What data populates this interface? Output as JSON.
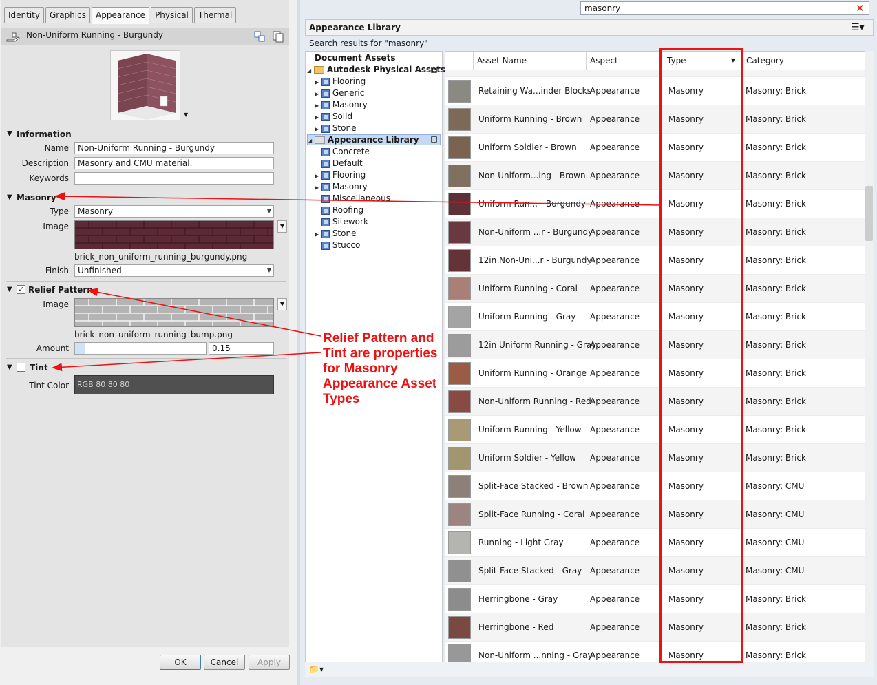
{
  "tabs": [
    "Identity",
    "Graphics",
    "Appearance",
    "Physical",
    "Thermal"
  ],
  "active_tab": "Appearance",
  "asset_title": "Non-Uniform Running - Burgundy",
  "information": {
    "heading": "Information",
    "name_label": "Name",
    "name_value": "Non-Uniform Running - Burgundy",
    "desc_label": "Description",
    "desc_value": "Masonry and CMU material.",
    "keywords_label": "Keywords",
    "keywords_value": ""
  },
  "masonry": {
    "heading": "Masonry",
    "type_label": "Type",
    "type_value": "Masonry",
    "image_label": "Image",
    "image_file": "brick_non_uniform_running_burgundy.png",
    "finish_label": "Finish",
    "finish_value": "Unfinished"
  },
  "relief": {
    "heading": "Relief Pattern",
    "checked": true,
    "image_label": "Image",
    "image_file": "brick_non_uniform_running_bump.png",
    "amount_label": "Amount",
    "amount_value": "0.15",
    "amount_fraction": 0.15
  },
  "tint": {
    "heading": "Tint",
    "checked": false,
    "color_label": "Tint Color",
    "color_value": "RGB 80 80 80"
  },
  "buttons": {
    "ok": "OK",
    "cancel": "Cancel",
    "apply": "Apply"
  },
  "search": {
    "value": "masonry"
  },
  "library": {
    "title": "Appearance Library",
    "search_results": "Search results for \"masonry\"",
    "tree": {
      "document_assets": "Document Assets",
      "physical_assets": "Autodesk Physical Assets",
      "physical_children": [
        "Flooring",
        "Generic",
        "Masonry",
        "Solid",
        "Stone"
      ],
      "appearance_library": "Appearance Library",
      "appearance_children": [
        "Concrete",
        "Default",
        "Flooring",
        "Masonry",
        "Miscellaneous",
        "Roofing",
        "Sitework",
        "Stone",
        "Stucco"
      ]
    },
    "columns": [
      "Asset Name",
      "Aspect",
      "Type",
      "Category"
    ],
    "rows": [
      {
        "name": "Retaining Wa...inder Blocks",
        "aspect": "Appearance",
        "type": "Masonry",
        "category": "Masonry: Brick",
        "color": "#8a8a82"
      },
      {
        "name": "Uniform Running - Brown",
        "aspect": "Appearance",
        "type": "Masonry",
        "category": "Masonry: Brick",
        "color": "#7d6a56"
      },
      {
        "name": "Uniform Soldier - Brown",
        "aspect": "Appearance",
        "type": "Masonry",
        "category": "Masonry: Brick",
        "color": "#7a6450"
      },
      {
        "name": "Non-Uniform...ing - Brown",
        "aspect": "Appearance",
        "type": "Masonry",
        "category": "Masonry: Brick",
        "color": "#807060"
      },
      {
        "name": "Uniform Run... - Burgundy",
        "aspect": "Appearance",
        "type": "Masonry",
        "category": "Masonry: Brick",
        "color": "#5e3038"
      },
      {
        "name": "Non-Uniform ...r - Burgundy",
        "aspect": "Appearance",
        "type": "Masonry",
        "category": "Masonry: Brick",
        "color": "#6a3840"
      },
      {
        "name": "12in Non-Uni...r - Burgundy",
        "aspect": "Appearance",
        "type": "Masonry",
        "category": "Masonry: Brick",
        "color": "#643338"
      },
      {
        "name": "Uniform Running - Coral",
        "aspect": "Appearance",
        "type": "Masonry",
        "category": "Masonry: Brick",
        "color": "#a88078"
      },
      {
        "name": "Uniform Running - Gray",
        "aspect": "Appearance",
        "type": "Masonry",
        "category": "Masonry: Brick",
        "color": "#a4a4a4"
      },
      {
        "name": "12in Uniform Running - Gray",
        "aspect": "Appearance",
        "type": "Masonry",
        "category": "Masonry: Brick",
        "color": "#9c9c9c"
      },
      {
        "name": "Uniform Running - Orange",
        "aspect": "Appearance",
        "type": "Masonry",
        "category": "Masonry: Brick",
        "color": "#9a5c44"
      },
      {
        "name": "Non-Uniform Running - Red",
        "aspect": "Appearance",
        "type": "Masonry",
        "category": "Masonry: Brick",
        "color": "#8a4a44"
      },
      {
        "name": "Uniform Running - Yellow",
        "aspect": "Appearance",
        "type": "Masonry",
        "category": "Masonry: Brick",
        "color": "#a89a74"
      },
      {
        "name": "Uniform Soldier - Yellow",
        "aspect": "Appearance",
        "type": "Masonry",
        "category": "Masonry: Brick",
        "color": "#a29670"
      },
      {
        "name": "Split-Face Stacked - Brown",
        "aspect": "Appearance",
        "type": "Masonry",
        "category": "Masonry: CMU",
        "color": "#8c8078"
      },
      {
        "name": "Split-Face Running - Coral",
        "aspect": "Appearance",
        "type": "Masonry",
        "category": "Masonry: CMU",
        "color": "#9c8480"
      },
      {
        "name": "Running - Light Gray",
        "aspect": "Appearance",
        "type": "Masonry",
        "category": "Masonry: CMU",
        "color": "#b4b4b0"
      },
      {
        "name": "Split-Face Stacked - Gray",
        "aspect": "Appearance",
        "type": "Masonry",
        "category": "Masonry: CMU",
        "color": "#909090"
      },
      {
        "name": "Herringbone - Gray",
        "aspect": "Appearance",
        "type": "Masonry",
        "category": "Masonry: Brick",
        "color": "#8c8c8c"
      },
      {
        "name": "Herringbone - Red",
        "aspect": "Appearance",
        "type": "Masonry",
        "category": "Masonry: Brick",
        "color": "#7a4a40"
      },
      {
        "name": "Non-Uniform ...nning - Gray",
        "aspect": "Appearance",
        "type": "Masonry",
        "category": "Masonry: Brick",
        "color": "#989898"
      }
    ]
  },
  "annotation": [
    "Relief Pattern and",
    "Tint are properties",
    "for Masonry",
    "Appearance Asset",
    "Types"
  ],
  "colors": {
    "annotation_red": "#e11111",
    "selection": "#c7d9f2"
  }
}
